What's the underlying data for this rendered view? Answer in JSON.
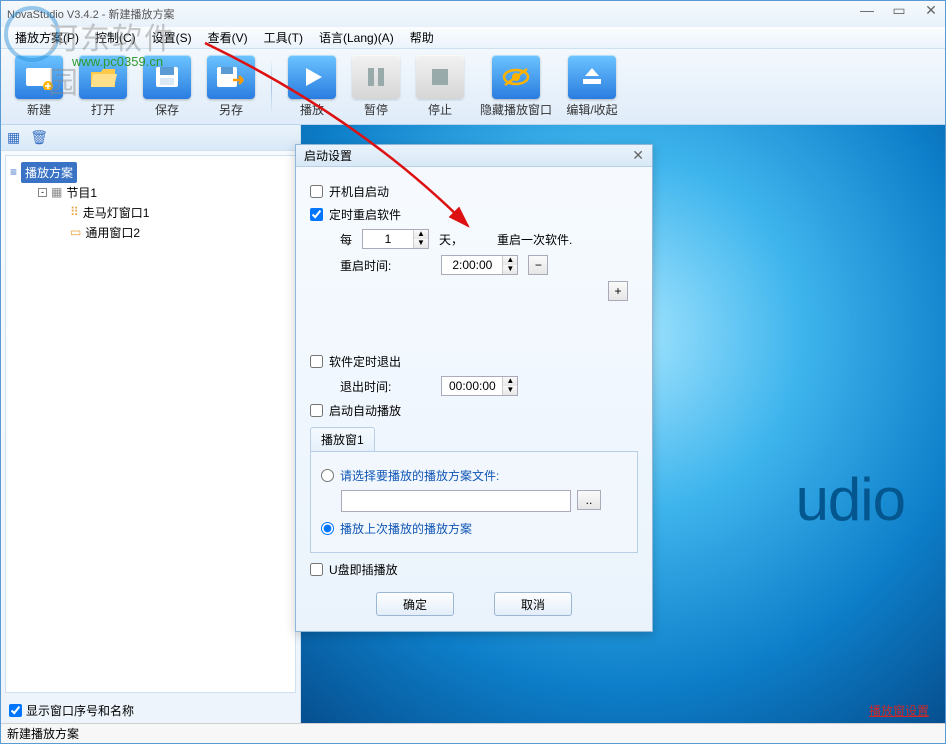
{
  "title": "NovaStudio V3.4.2 - 新建播放方案",
  "menu": [
    "播放方案(P)",
    "控制(C)",
    "设置(S)",
    "查看(V)",
    "工具(T)",
    "语言(Lang)(A)",
    "帮助"
  ],
  "toolbar": [
    {
      "label": "新建",
      "kind": "blue"
    },
    {
      "label": "打开",
      "kind": "blue"
    },
    {
      "label": "保存",
      "kind": "blue"
    },
    {
      "label": "另存",
      "kind": "blue"
    },
    {
      "label": "播放",
      "kind": "blue"
    },
    {
      "label": "暂停",
      "kind": "gray"
    },
    {
      "label": "停止",
      "kind": "gray"
    },
    {
      "label": "隐藏播放窗口",
      "kind": "blue"
    },
    {
      "label": "编辑/收起",
      "kind": "blue"
    }
  ],
  "tree": {
    "root": "播放方案",
    "item1": "节目1",
    "item2": "走马灯窗口1",
    "item3": "通用窗口2"
  },
  "show_seq_label": "显示窗口序号和名称",
  "preview_brand": "udio",
  "preview_link": "播放窗设置",
  "status": "新建播放方案",
  "dialog": {
    "title": "启动设置",
    "auto_start": "开机自启动",
    "timed_restart": "定时重启软件",
    "every": "每",
    "days_value": "1",
    "days_unit": "天，",
    "restart_once": "重启一次软件.",
    "restart_time_label": "重启时间:",
    "restart_time": "2:00:00",
    "timed_exit": "软件定时退出",
    "exit_time_label": "退出时间:",
    "exit_time": "00:00:00",
    "auto_play": "启动自动播放",
    "tab": "播放窗1",
    "radio_select": "请选择要播放的播放方案文件:",
    "browse": "..",
    "radio_last": "播放上次播放的播放方案",
    "usb_play": "U盘即插播放",
    "ok": "确定",
    "cancel": "取消"
  },
  "watermark_text": "河东软件园",
  "watermark_url": "www.pc0359.cn"
}
